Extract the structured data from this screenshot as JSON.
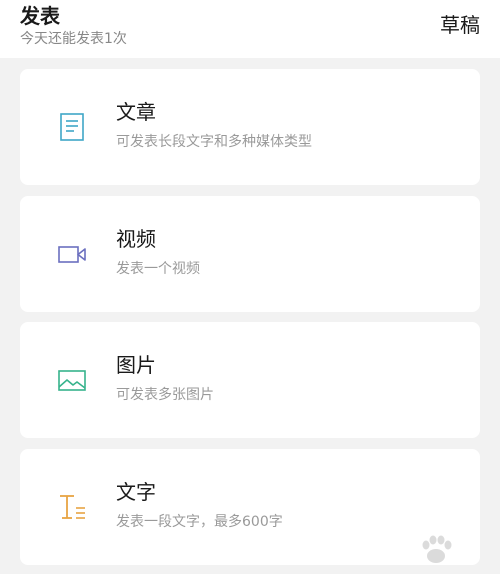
{
  "header": {
    "title": "发表",
    "subtitle": "今天还能发表1次",
    "drafts_label": "草稿"
  },
  "cards": [
    {
      "title": "文章",
      "description": "可发表长段文字和多种媒体类型",
      "icon": "article-icon",
      "color": "#3fa6c7"
    },
    {
      "title": "视频",
      "description": "发表一个视频",
      "icon": "video-icon",
      "color": "#6b6fbf"
    },
    {
      "title": "图片",
      "description": "可发表多张图片",
      "icon": "image-icon",
      "color": "#36b38c"
    },
    {
      "title": "文字",
      "description": "发表一段文字，最多600字",
      "icon": "text-icon",
      "color": "#e8a443"
    }
  ]
}
